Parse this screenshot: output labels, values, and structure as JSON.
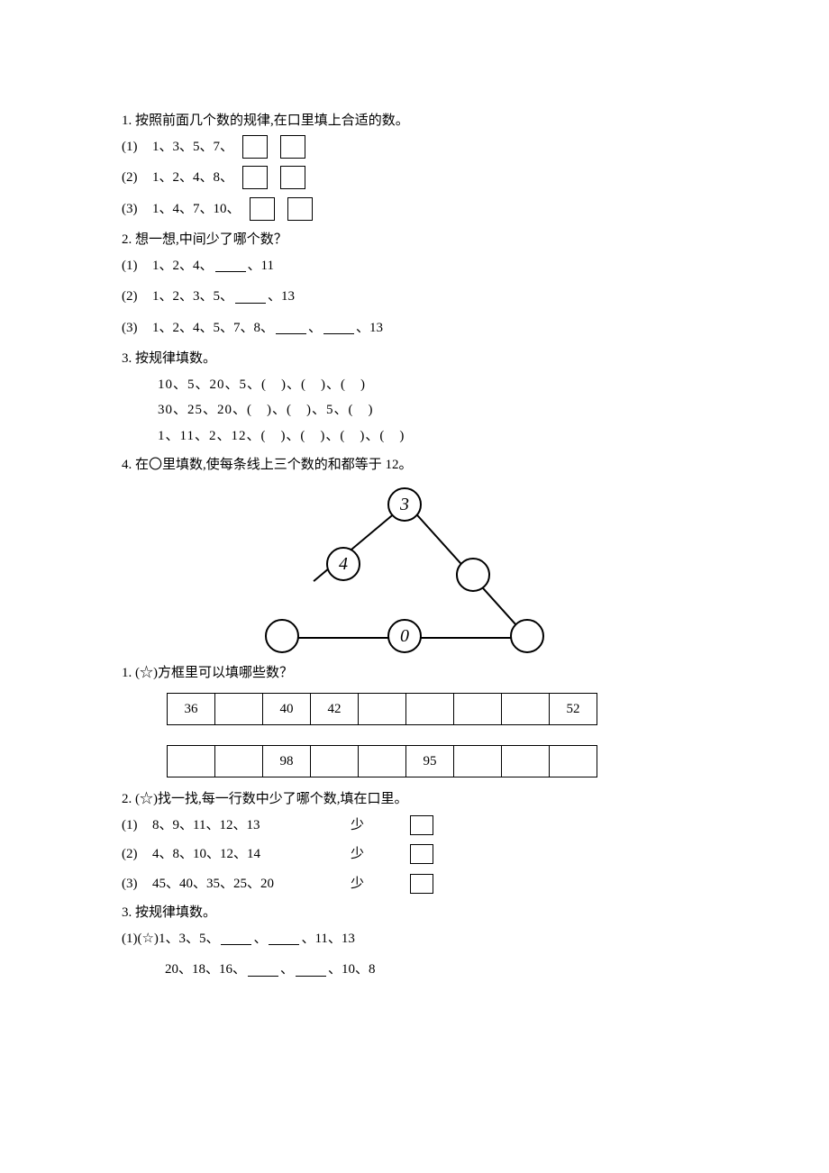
{
  "q1": {
    "title": "1. 按照前面几个数的规律,在口里填上合适的数。",
    "items": [
      {
        "label": "(1)",
        "seq": "1、3、5、7、"
      },
      {
        "label": "(2)",
        "seq": "1、2、4、8、"
      },
      {
        "label": "(3)",
        "seq": "1、4、7、10、"
      }
    ]
  },
  "q2": {
    "title": "2. 想一想,中间少了哪个数？",
    "items": [
      {
        "label": "(1)",
        "pre": "1、2、4、",
        "post": "、11",
        "blanks": 1
      },
      {
        "label": "(2)",
        "pre": "1、2、3、5、",
        "post": "、13",
        "blanks": 1
      },
      {
        "label": "(3)",
        "pre": "1、2、4、5、7、8、",
        "post": "、13",
        "blanks": 2
      }
    ]
  },
  "q3": {
    "title": "3. 按规律填数。",
    "lines": [
      "10、5、20、5、(　)、(　)、(　)",
      "30、25、20、(　)、(　)、5、(　)",
      "1、11、2、12、(　)、(　)、(　)、(　)"
    ]
  },
  "q4": {
    "title": "4. 在〇里填数,使每条线上三个数的和都等于 12。",
    "nodes": {
      "top": "3",
      "midleft": "4",
      "midright": "",
      "botleft": "",
      "botmid": "0",
      "botright": ""
    }
  },
  "q5": {
    "title": "1. (☆)方框里可以填哪些数？",
    "row1": [
      "36",
      "",
      "40",
      "42",
      "",
      "",
      "",
      "",
      "52"
    ],
    "row2": [
      "",
      "",
      "98",
      "",
      "",
      "95",
      "",
      "",
      ""
    ]
  },
  "q6": {
    "title": "2. (☆)找一找,每一行数中少了哪个数,填在口里。",
    "shao": "少",
    "items": [
      {
        "label": "(1)",
        "seq": "8、9、11、12、13"
      },
      {
        "label": "(2)",
        "seq": "4、8、10、12、14"
      },
      {
        "label": "(3)",
        "seq": "45、40、35、25、20"
      }
    ]
  },
  "q7": {
    "title": "3. 按规律填数。",
    "line1_label": "(1)(☆)",
    "line1_pre": "1、3、5、",
    "line1_post": "、11、13",
    "line2_pre": "20、18、16、",
    "line2_post": "、10、8"
  }
}
